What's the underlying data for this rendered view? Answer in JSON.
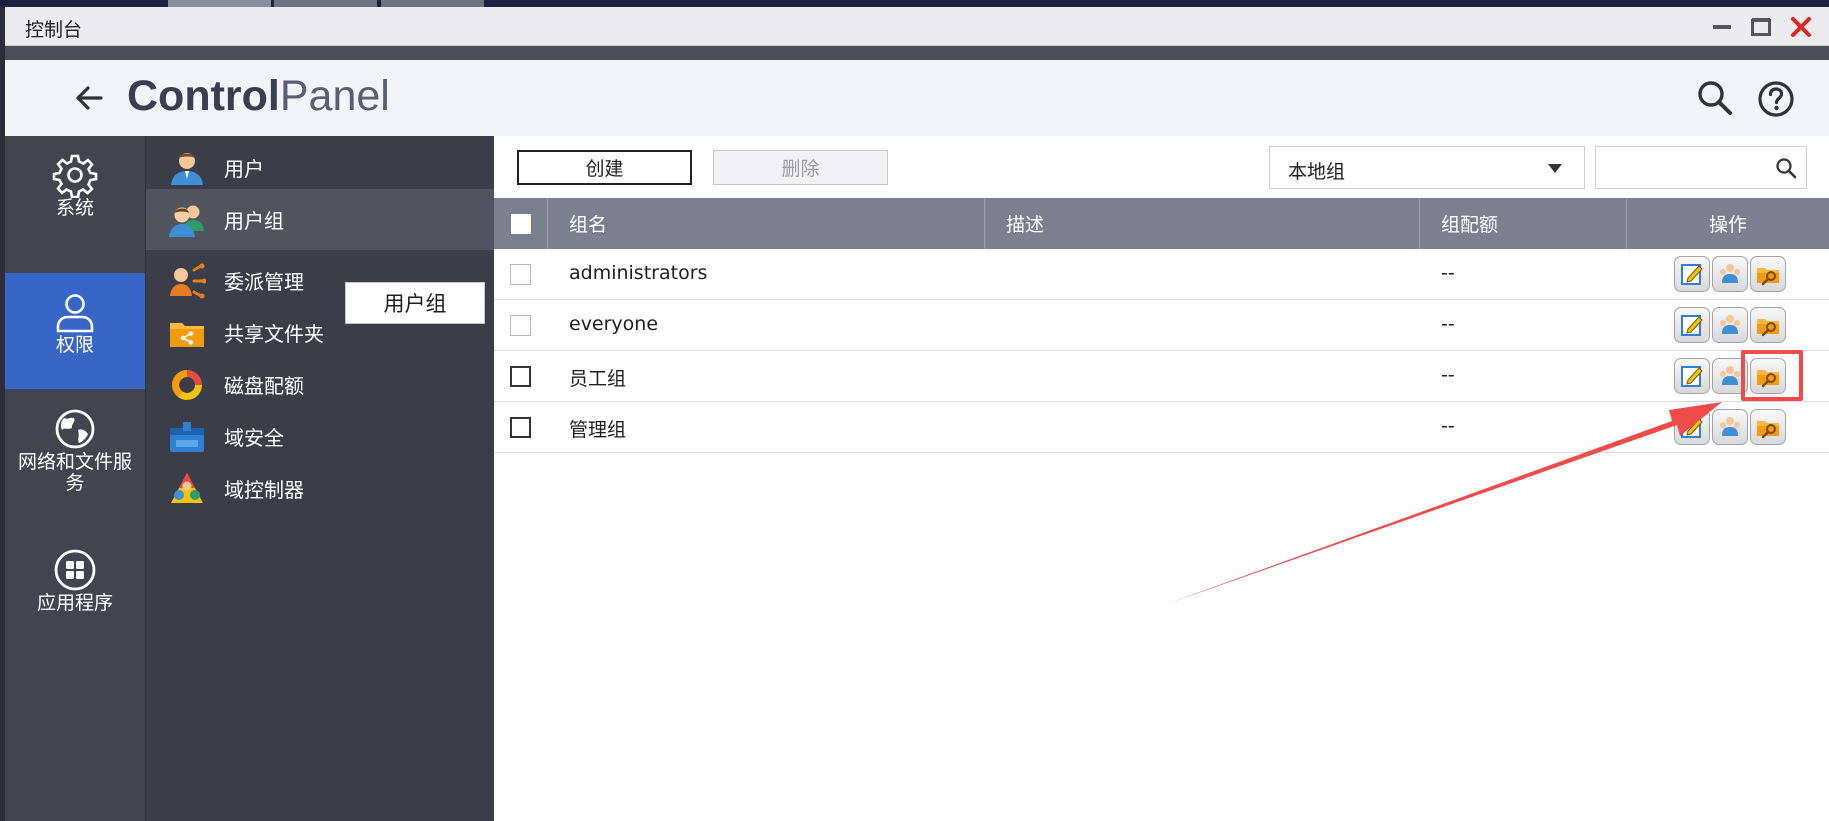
{
  "window": {
    "title": "控制台",
    "minimize_icon": "minimize-icon",
    "maximize_icon": "maximize-icon",
    "close_icon": "close-icon"
  },
  "header": {
    "brand_bold": "Control",
    "brand_light": "Panel",
    "back_icon": "back-arrow-icon",
    "search_icon": "search-icon",
    "help_icon": "help-icon"
  },
  "rail": {
    "items": [
      {
        "label": "系统",
        "icon": "gear-icon",
        "active": false
      },
      {
        "label": "权限",
        "icon": "user-icon",
        "active": true
      },
      {
        "label": "网络和文件服务",
        "icon": "globe-icon",
        "active": false
      },
      {
        "label": "应用程序",
        "icon": "apps-grid-icon",
        "active": false
      }
    ]
  },
  "submenu": {
    "items": [
      {
        "label": "用户",
        "icon": "user-icon",
        "active": false
      },
      {
        "label": "用户组",
        "icon": "user-group-icon",
        "active": true
      },
      {
        "label": "委派管理",
        "icon": "delegate-icon",
        "active": false
      },
      {
        "label": "共享文件夹",
        "icon": "shared-folder-icon",
        "active": false
      },
      {
        "label": "磁盘配额",
        "icon": "disk-quota-icon",
        "active": false
      },
      {
        "label": "域安全",
        "icon": "domain-security-icon",
        "active": false
      },
      {
        "label": "域控制器",
        "icon": "domain-controller-icon",
        "active": false
      }
    ],
    "tooltip": "用户组"
  },
  "toolbar": {
    "create_label": "创建",
    "delete_label": "删除",
    "group_type_selected": "本地组",
    "search_placeholder": "",
    "search_icon": "search-icon"
  },
  "table": {
    "columns": [
      "组名",
      "描述",
      "组配额",
      "操作"
    ],
    "rows": [
      {
        "name": "administrators",
        "description": "",
        "quota": "--"
      },
      {
        "name": "everyone",
        "description": "",
        "quota": "--"
      },
      {
        "name": "员工组",
        "description": "",
        "quota": "--"
      },
      {
        "name": "管理组",
        "description": "",
        "quota": "--"
      }
    ],
    "action_icons": [
      "edit-icon",
      "group-members-icon",
      "folder-permission-icon"
    ]
  },
  "annotation": {
    "highlight_color": "#ef4b4b",
    "highlighted_row": "员工组",
    "highlighted_action": "folder-permission-icon"
  }
}
